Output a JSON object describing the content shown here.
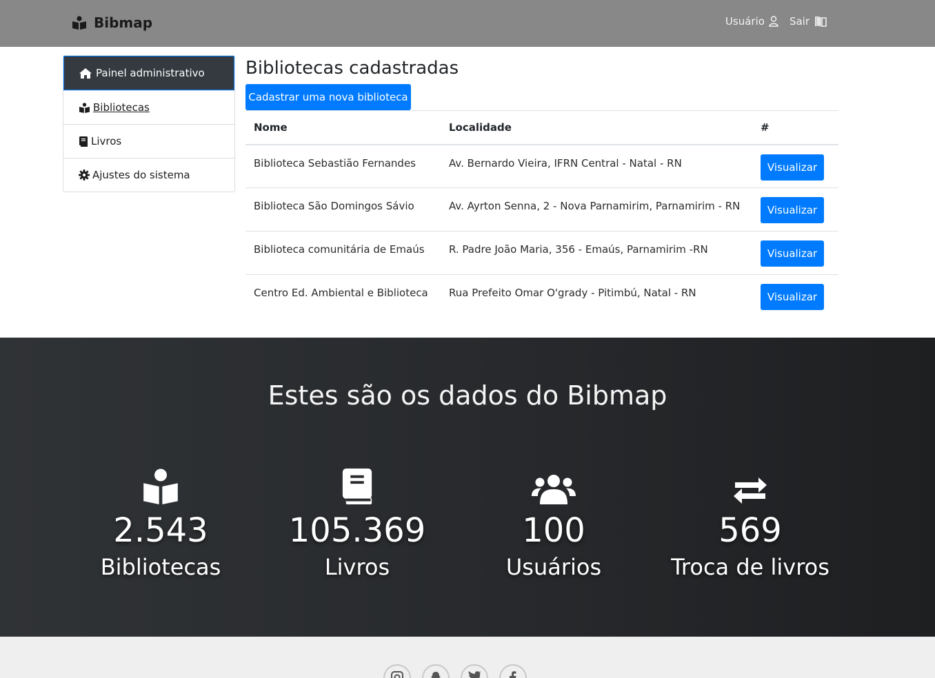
{
  "navbar": {
    "brand": "Bibmap",
    "user_link": "Usuário",
    "logout_link": "Sair"
  },
  "sidebar": {
    "items": [
      {
        "label": "Painel administrativo",
        "icon": "home-icon"
      },
      {
        "label": "Bibliotecas",
        "icon": "reader-icon"
      },
      {
        "label": "Livros",
        "icon": "book-icon"
      },
      {
        "label": "Ajustes do sistema",
        "icon": "gear-icon"
      }
    ]
  },
  "main": {
    "title": "Bibliotecas cadastradas",
    "new_button": "Cadastrar uma nova biblioteca",
    "table": {
      "headers": [
        "Nome",
        "Localidade",
        "#"
      ],
      "rows": [
        {
          "nome": "Biblioteca Sebastião Fernandes",
          "localidade": "Av. Bernardo Vieira, IFRN Central - Natal - RN",
          "action": "Visualizar"
        },
        {
          "nome": "Biblioteca São Domingos Sávio",
          "localidade": "Av. Ayrton Senna, 2 - Nova Parnamirim, Parnamirim - RN",
          "action": "Visualizar"
        },
        {
          "nome": "Biblioteca comunitária de Emaús",
          "localidade": "R. Padre João Maria, 356 - Emaús, Parnamirim -RN",
          "action": "Visualizar"
        },
        {
          "nome": "Centro Ed. Ambiental e Biblioteca",
          "localidade": "Rua Prefeito Omar O'grady - Pitimbú, Natal - RN",
          "action": "Visualizar"
        }
      ]
    }
  },
  "stats": {
    "title": "Estes são os dados do Bibmap",
    "items": [
      {
        "value": "2.543",
        "label": "Bibliotecas",
        "icon": "reader-icon"
      },
      {
        "value": "105.369",
        "label": "Livros",
        "icon": "book-icon"
      },
      {
        "value": "100",
        "label": "Usuários",
        "icon": "users-icon"
      },
      {
        "value": "569",
        "label": "Troca de livros",
        "icon": "exchange-icon"
      }
    ]
  },
  "footer": {
    "social": [
      "instagram-icon",
      "snapchat-icon",
      "twitter-icon",
      "facebook-icon"
    ]
  },
  "colors": {
    "navbar": "#888888",
    "primary": "#007bff",
    "sidebar_active": "#343a40",
    "stats_bg": "#2a2c2f",
    "footer_bg": "#efefef"
  }
}
